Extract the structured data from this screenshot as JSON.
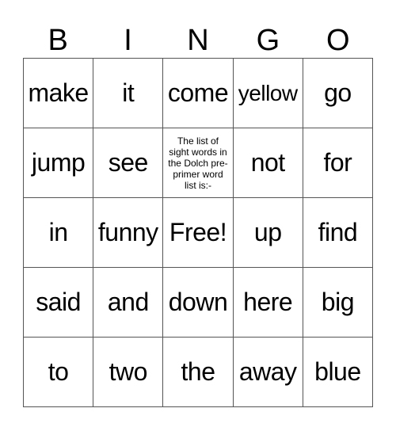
{
  "header": [
    "B",
    "I",
    "N",
    "G",
    "O"
  ],
  "cells": [
    [
      "make",
      "it",
      "come",
      "yellow",
      "go"
    ],
    [
      "jump",
      "see",
      "The list of sight words in the Dolch pre-primer word list is:-",
      "not",
      "for"
    ],
    [
      "in",
      "funny",
      "Free!",
      "up",
      "find"
    ],
    [
      "said",
      "and",
      "down",
      "here",
      "big"
    ],
    [
      "to",
      "two",
      "the",
      "away",
      "blue"
    ]
  ]
}
